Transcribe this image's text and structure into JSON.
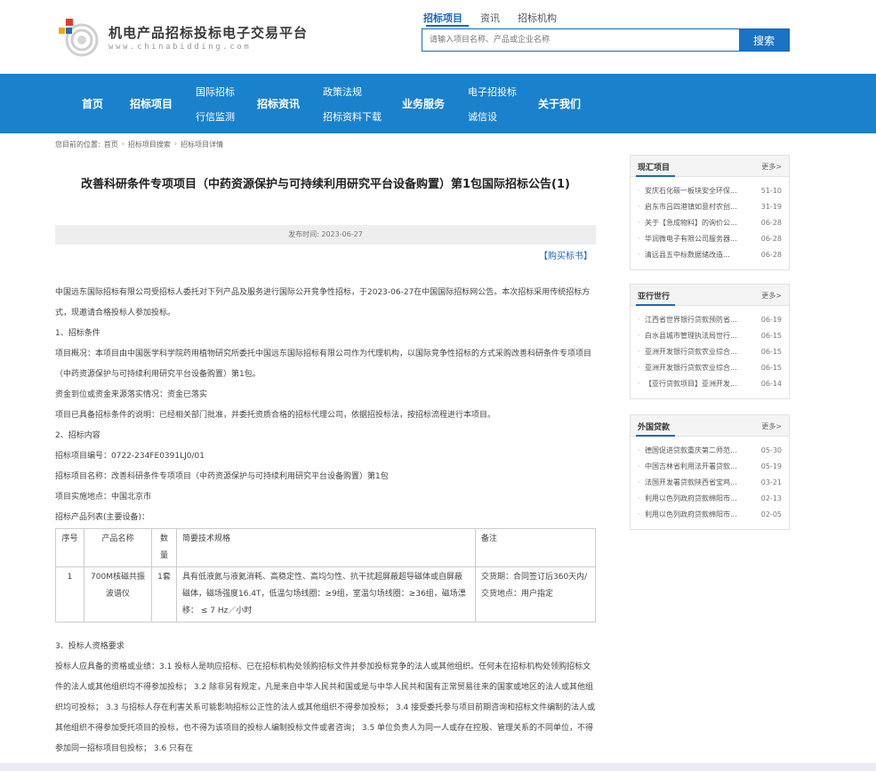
{
  "header": {
    "logo_title": "机电产品招标投标电子交易平台",
    "logo_url": "www.chinabidding.com",
    "search_tabs": [
      "招标项目",
      "资讯",
      "招标机构"
    ],
    "search_placeholder": "请输入项目名称、产品或企业名称",
    "search_button": "搜索"
  },
  "nav": {
    "home": "首页",
    "bid_projects": "招标项目",
    "intl_bid": "国际招标",
    "monitor": "行信监测",
    "bid_news": "招标资讯",
    "policy": "政策法规",
    "docs_download": "招标资料下载",
    "business": "业务服务",
    "e_bid": "电子招投标",
    "credit": "诚信设",
    "about": "关于我们"
  },
  "breadcrumb": {
    "prefix": "您目前的位置:",
    "items": [
      "首页",
      "招标项目搜索",
      "招标项目详情"
    ]
  },
  "article": {
    "title": "改善科研条件专项项目（中药资源保护与可持续利用研究平台设备购置）第1包国际招标公告(1)",
    "published": "发布时间: 2023-06-27",
    "buy_link": "【购买标书】",
    "intro": "中国远东国际招标有限公司受招标人委托对下列产品及服务进行国际公开竞争性招标，于2023-06-27在中国国际招标网公告。本次招标采用传统招标方式，现邀请合格投标人参加投标。",
    "s1_title": "1、招标条件",
    "s1_overview": "项目概况：本项目由中国医学科学院药用植物研究所委托中国远东国际招标有限公司作为代理机构，以国际竞争性招标的方式采购改善科研条件专项项目（中药资源保护与可持续利用研究平台设备购置）第1包。",
    "s1_funds": "资金到位或资金来源落实情况：资金已落实",
    "s1_ready": "项目已具备招标条件的说明：已经相关部门批准，并委托资质合格的招标代理公司，依据招投标法，按招标流程进行本项目。",
    "s2_title": "2、招标内容",
    "s2_code": "招标项目编号：0722-234FE0391LJ0/01",
    "s2_name": "招标项目名称：改善科研条件专项项目（中药资源保护与可持续利用研究平台设备购置）第1包",
    "s2_place": "项目实施地点：中国北京市",
    "s2_list": "招标产品列表(主要设备)：",
    "table": {
      "headers": [
        "序号",
        "产品名称",
        "数量",
        "简要技术规格",
        "备注"
      ],
      "rows": [
        [
          "1",
          "700M核磁共振波谱仪",
          "1套",
          "具有低液氮与液氦消耗、高稳定性、高均匀性、抗干扰超屏蔽超导磁体或自屏蔽磁体，磁场强度16.4T，低温匀场线圈：≥9组，室温匀场线圈：≥36组，磁场漂移： ≤ 7 Hz／小时",
          "交货期：合同签订后360天内/交货地点：用户指定"
        ]
      ]
    },
    "s3_title": "3、投标人资格要求",
    "s3_text": "投标人应具备的资格或业绩：3.1 投标人是响应招标、已在招标机构处领购招标文件并参加投标竞争的法人或其他组织。任何未在招标机构处领购招标文件的法人或其他组织均不得参加投标； 3.2 除非另有规定，凡是来自中华人民共和国或是与中华人民共和国有正常贸易往来的国家或地区的法人或其他组织均可投标； 3.3 与招标人存在利害关系可能影响招标公正性的法人或其他组织不得参加投标； 3.4 接受委托参与项目前期咨询和招标文件编制的法人或其他组织不得参加受托项目的投标，也不得为该项目的投标人编制投标文件或者咨询； 3.5 单位负责人为同一人或存在控股、管理关系的不同单位，不得参加同一招标项目包投标； 3.6 只有在"
  },
  "sidebar": {
    "more_label": "更多>",
    "boxes": [
      {
        "title": "现汇项目",
        "items": [
          {
            "text": "安庆石化碳一板块安全环保...",
            "date": "51-10"
          },
          {
            "text": "启东市吕四港镇如意村农创...",
            "date": "31-19"
          },
          {
            "text": "关于【急成物料】的询价公...",
            "date": "06-28"
          },
          {
            "text": "华润微电子有限公司服务器...",
            "date": "06-28"
          },
          {
            "text": "清远县五中标数据储改造...",
            "date": "06-28"
          }
        ]
      },
      {
        "title": "亚行世行",
        "items": [
          {
            "text": "江西省世界银行贷款预防省...",
            "date": "06-19"
          },
          {
            "text": "白水县城市管理执法局世行...",
            "date": "06-15"
          },
          {
            "text": "亚洲开发银行贷款农业综合...",
            "date": "06-15"
          },
          {
            "text": "亚洲开发银行贷款农业综合...",
            "date": "06-15"
          },
          {
            "text": "【亚行贷款项目】亚洲开发...",
            "date": "06-14"
          }
        ]
      },
      {
        "title": "外国贷款",
        "items": [
          {
            "text": "德国促进贷款重庆第二师范...",
            "date": "05-30"
          },
          {
            "text": "中国吉林省利用法开署贷款...",
            "date": "05-19"
          },
          {
            "text": "法国开发署贷款陕西省宝鸡...",
            "date": "03-21"
          },
          {
            "text": "利用以色列政府贷款绵阳市...",
            "date": "02-13"
          },
          {
            "text": "利用以色列政府贷款绵阳市...",
            "date": "02-05"
          }
        ]
      }
    ]
  }
}
